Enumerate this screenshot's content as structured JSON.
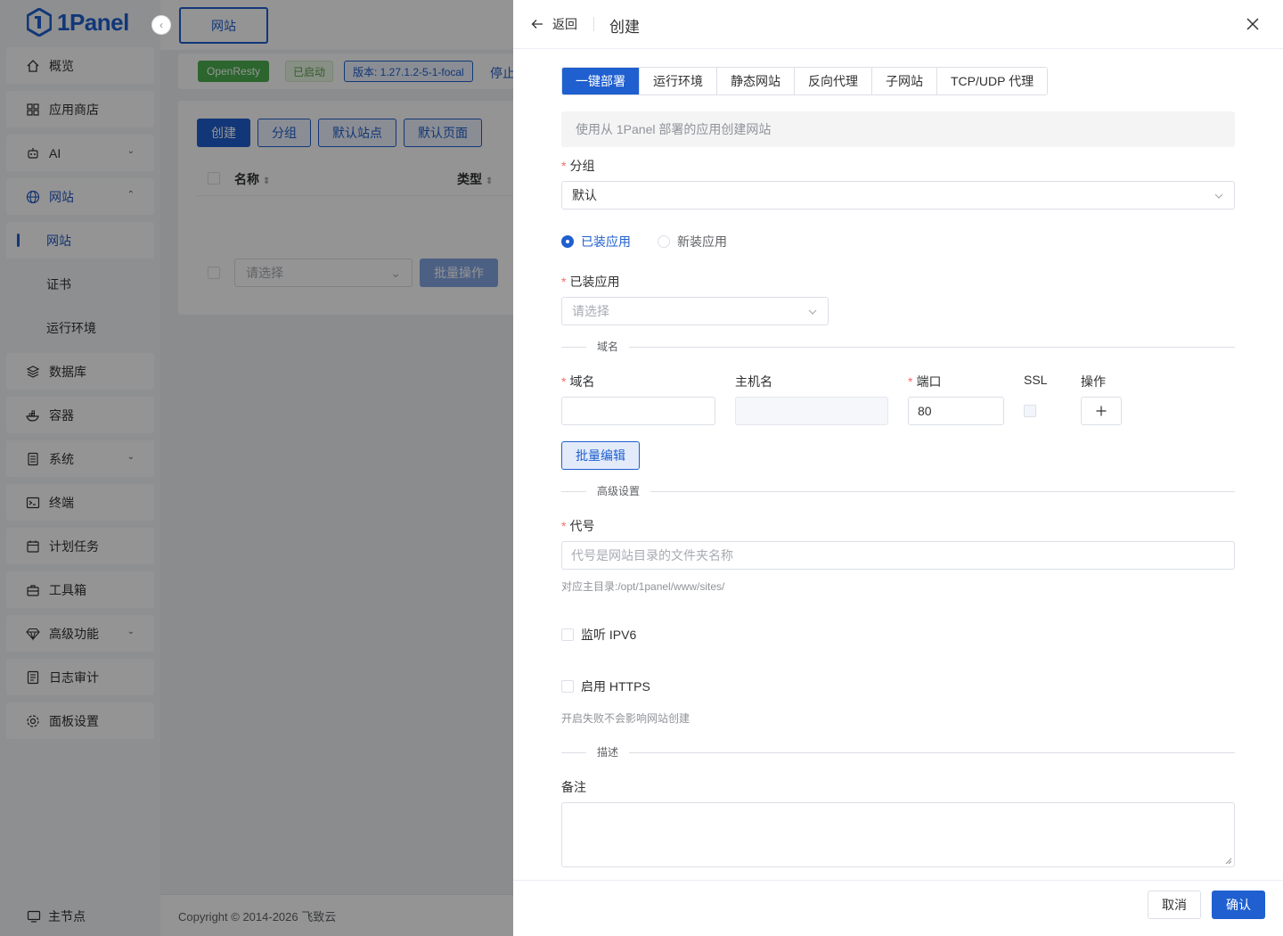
{
  "app": {
    "logo_text": "1Panel",
    "brand_color": "#1f5fcf",
    "top_tab": "网站",
    "status": {
      "server": "OpenResty",
      "state": "已启动",
      "version": "版本: 1.27.1.2-5-1-focal",
      "stop": "停止"
    },
    "toolbar": {
      "create": "创建",
      "group": "分组",
      "default_site": "默认站点",
      "default_page": "默认页面"
    },
    "table_headers": {
      "name": "名称",
      "type": "类型"
    },
    "bulk_select_placeholder": "请选择",
    "bulk_action": "批量操作",
    "copyright": "Copyright © 2014-2026 飞致云",
    "main_node": "主节点"
  },
  "sidebar": {
    "items": [
      {
        "label": "概览",
        "icon": "home-icon"
      },
      {
        "label": "应用商店",
        "icon": "apps-icon"
      },
      {
        "label": "AI",
        "icon": "robot-icon",
        "arrow": "down"
      },
      {
        "label": "网站",
        "icon": "globe-icon",
        "arrow": "up"
      },
      {
        "label": "网站",
        "sub": true,
        "active": true
      },
      {
        "label": "证书",
        "sub": true
      },
      {
        "label": "运行环境",
        "sub": true
      },
      {
        "label": "数据库",
        "icon": "layers-icon"
      },
      {
        "label": "容器",
        "icon": "docker-icon"
      },
      {
        "label": "系统",
        "icon": "server-icon",
        "arrow": "down"
      },
      {
        "label": "终端",
        "icon": "terminal-icon"
      },
      {
        "label": "计划任务",
        "icon": "calendar-icon"
      },
      {
        "label": "工具箱",
        "icon": "toolbox-icon"
      },
      {
        "label": "高级功能",
        "icon": "diamond-icon",
        "arrow": "down"
      },
      {
        "label": "日志审计",
        "icon": "log-icon"
      },
      {
        "label": "面板设置",
        "icon": "gear-icon"
      }
    ]
  },
  "drawer": {
    "back": "返回",
    "title": "创建",
    "tabs": [
      "一键部署",
      "运行环境",
      "静态网站",
      "反向代理",
      "子网站",
      "TCP/UDP 代理"
    ],
    "active_tab": 0,
    "alert": "使用从 1Panel 部署的应用创建网站",
    "group_label": "分组",
    "group_value": "默认",
    "radio_installed": "已装应用",
    "radio_new": "新装应用",
    "installed_app_label": "已装应用",
    "installed_app_placeholder": "请选择",
    "domain_section": "域名",
    "domain_cols": {
      "domain": "域名",
      "host": "主机名",
      "port": "端口",
      "ssl": "SSL",
      "ops": "操作"
    },
    "port_value": "80",
    "batch_edit": "批量编辑",
    "advanced_section": "高级设置",
    "alias_label": "代号",
    "alias_placeholder": "代号是网站目录的文件夹名称",
    "alias_hint": "对应主目录:/opt/1panel/www/sites/",
    "ipv6_label": "监听 IPV6",
    "https_label": "启用 HTTPS",
    "https_hint": "开启失败不会影响网站创建",
    "desc_section": "描述",
    "remark_label": "备注",
    "cancel": "取消",
    "confirm": "确认"
  }
}
